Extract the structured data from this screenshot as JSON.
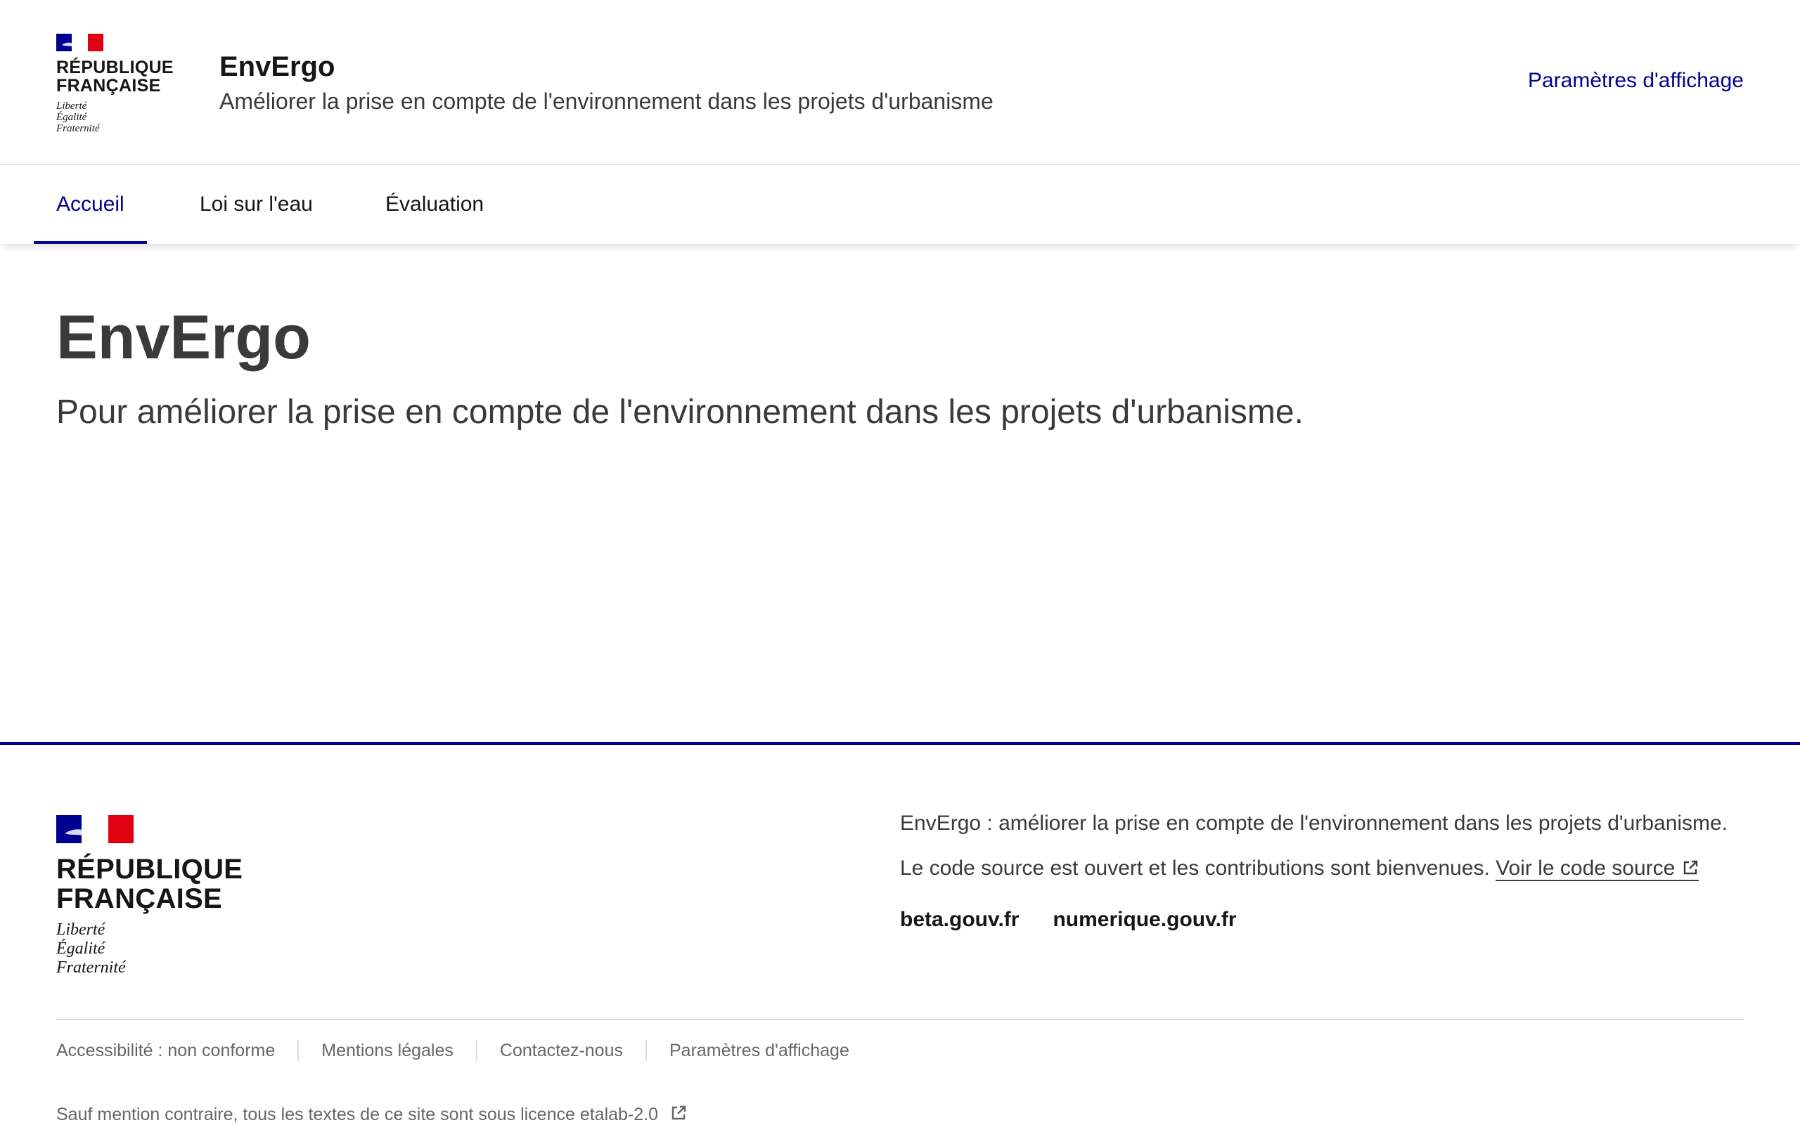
{
  "colors": {
    "accent": "#000091",
    "flag_blue": "#000091",
    "flag_red": "#e1000f",
    "text": "#161616",
    "muted": "#666666"
  },
  "header": {
    "rf_name_line1": "RÉPUBLIQUE",
    "rf_name_line2": "FRANÇAISE",
    "motto_line1": "Liberté",
    "motto_line2": "Égalité",
    "motto_line3": "Fraternité",
    "site_title": "EnvErgo",
    "tagline": "Améliorer la prise en compte de l'environnement dans les projets d'urbanisme",
    "display_settings": "Paramètres d'affichage"
  },
  "nav": {
    "items": [
      {
        "label": "Accueil"
      },
      {
        "label": "Loi sur l'eau"
      },
      {
        "label": "Évaluation"
      }
    ],
    "active": "Accueil"
  },
  "main": {
    "title": "EnvErgo",
    "lead": "Pour améliorer la prise en compte de l'environnement dans les projets d'urbanisme."
  },
  "footer": {
    "rf_name_line1": "RÉPUBLIQUE",
    "rf_name_line2": "FRANÇAISE",
    "motto_line1": "Liberté",
    "motto_line2": "Égalité",
    "motto_line3": "Fraternité",
    "description": "EnvErgo : améliorer la prise en compte de l'environnement dans les projets d'urbanisme.",
    "source_text": "Le code source est ouvert et les contributions sont bienvenues.",
    "source_link": "Voir le code source",
    "links": [
      "beta.gouv.fr",
      "numerique.gouv.fr"
    ],
    "bottom_links": [
      "Accessibilité : non conforme",
      "Mentions légales",
      "Contactez-nous",
      "Paramètres d'affichage"
    ],
    "license": "Sauf mention contraire, tous les textes de ce site sont sous licence etalab-2.0"
  }
}
